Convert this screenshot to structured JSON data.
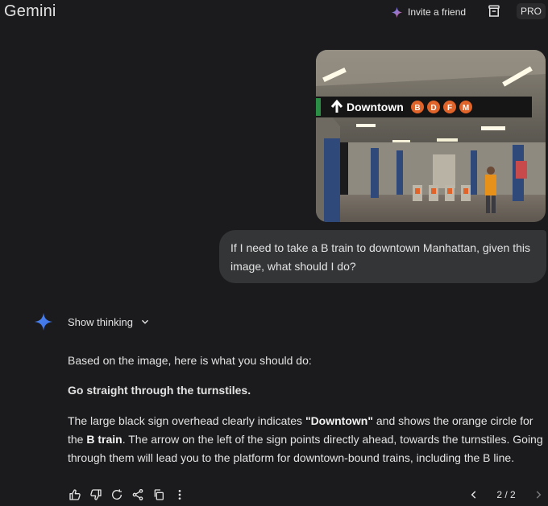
{
  "header": {
    "app_title": "Gemini",
    "invite_label": "Invite a friend",
    "pro_badge": "PRO"
  },
  "conversation": {
    "user_message": "If I need to take a B train to downtown Manhattan, given this image, what should I do?",
    "uploaded_image": {
      "sign_text": "Downtown",
      "train_lines": [
        "B",
        "D",
        "F",
        "M"
      ]
    },
    "show_thinking_label": "Show thinking",
    "response": {
      "intro": "Based on the image, here is what you should do:",
      "heading": "Go straight through the turnstiles.",
      "body_1": "The large black sign overhead clearly indicates ",
      "body_bold_1": "\"Downtown\"",
      "body_2": " and shows the orange circle for the ",
      "body_bold_2": "B train",
      "body_3": ". The arrow on the left of the sign points directly ahead, towards the turnstiles. Going through them will lead you to the platform for downtown-bound trains, including the B line."
    }
  },
  "actions": {
    "icons": [
      "thumbs-up-icon",
      "thumbs-down-icon",
      "regenerate-icon",
      "share-icon",
      "copy-icon",
      "more-vert-icon"
    ]
  },
  "pager": {
    "count": "2 / 2"
  },
  "colors": {
    "background": "#1b1b1d",
    "bubble": "#333537",
    "text": "#e3e3e3",
    "line_orange": "#e0632a",
    "gemini_blue": "#4e86f5"
  }
}
